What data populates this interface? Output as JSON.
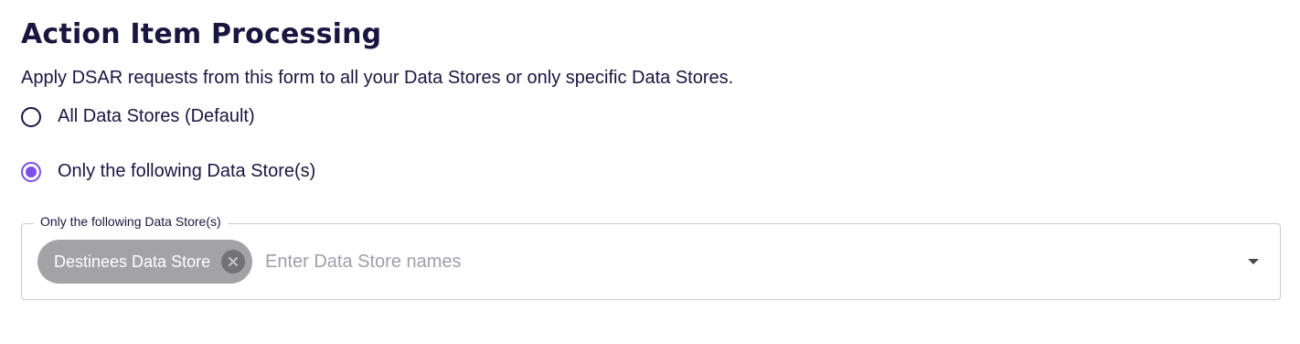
{
  "section": {
    "title": "Action Item Processing",
    "description": "Apply DSAR requests from this form to all your Data Stores or only specific Data Stores."
  },
  "radio_options": [
    {
      "label": "All Data Stores (Default)",
      "selected": false
    },
    {
      "label": "Only the following Data Store(s)",
      "selected": true
    }
  ],
  "data_store_field": {
    "legend": "Only the following Data Store(s)",
    "chips": [
      {
        "label": "Destinees Data Store"
      }
    ],
    "placeholder": "Enter Data Store names",
    "value": ""
  },
  "icons": {
    "chip_delete": "close-circle-icon",
    "dropdown": "caret-down-icon"
  },
  "colors": {
    "text": "#1b1640",
    "accent": "#7b4fe8",
    "chip_bg": "#a3a3a6",
    "placeholder": "#9f9fae"
  }
}
